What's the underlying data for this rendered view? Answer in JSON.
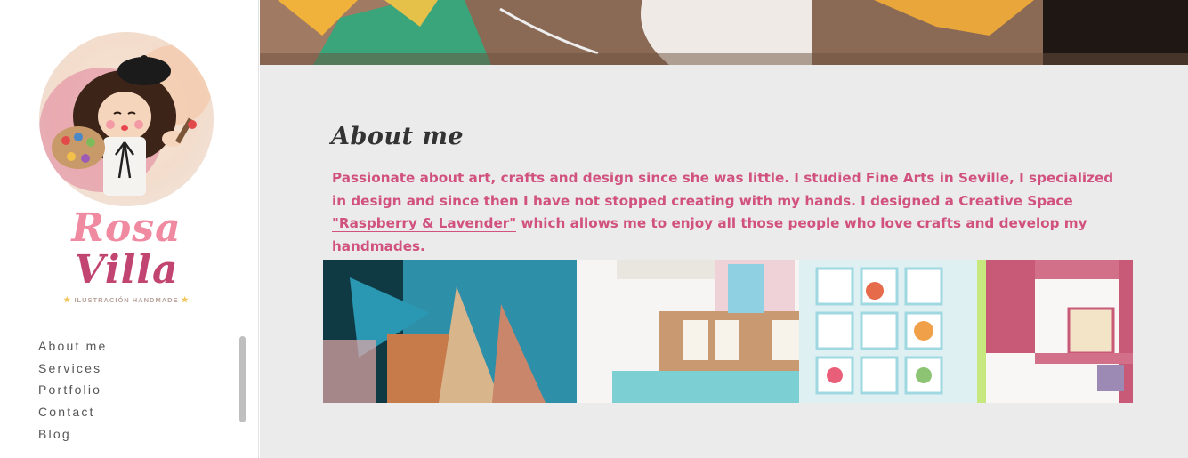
{
  "brand": {
    "name_line1": "Rosa",
    "name_line2": "Villa",
    "tagline": "ILUSTRACIÓN HANDMADE",
    "colors": {
      "pink": "#ef8aa1",
      "raspberry": "#c14570",
      "accent_text": "#d1527e"
    }
  },
  "nav": {
    "items": [
      {
        "label": "About me"
      },
      {
        "label": "Services"
      },
      {
        "label": "Portfolio"
      },
      {
        "label": "Contact"
      },
      {
        "label": "Blog"
      }
    ]
  },
  "about": {
    "title": "About me",
    "text_before_link": "Passionate about art, crafts and design since she was little. I studied Fine Arts in Seville, I specialized in design and since then I have not stopped creating with my hands. I designed a Creative Space ",
    "link_label": "\"Raspberry & Lavender\"",
    "text_after_link": " which allows me to enjoy all those people who love crafts and develop my handmades."
  }
}
